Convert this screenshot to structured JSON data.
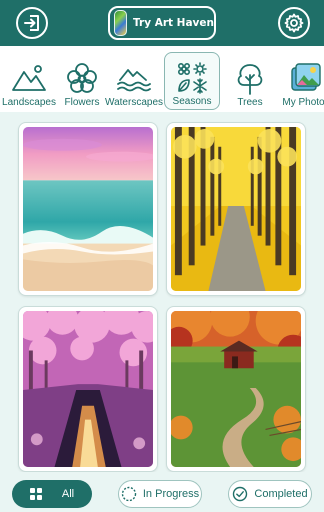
{
  "header": {
    "try_label": "Try Art Haven",
    "exit_icon": "exit-icon",
    "settings_icon": "gear-icon"
  },
  "categories": [
    {
      "label": "Landscapes",
      "icon": "mountains-icon"
    },
    {
      "label": "Flowers",
      "icon": "flower-icon"
    },
    {
      "label": "Waterscapes",
      "icon": "waves-icon"
    },
    {
      "label": "Seasons",
      "icon": "seasons-icon",
      "selected": true
    },
    {
      "label": "Trees",
      "icon": "tree-icon"
    },
    {
      "label": "My Photos",
      "icon": "photos-icon"
    }
  ],
  "artworks": [
    {
      "subject": "beach-sunset"
    },
    {
      "subject": "autumn-tree-road"
    },
    {
      "subject": "cherry-blossom-canal"
    },
    {
      "subject": "autumn-farm"
    }
  ],
  "filters": {
    "all_label": "All",
    "in_progress_label": "In Progress",
    "completed_label": "Completed",
    "active": "All"
  },
  "colors": {
    "primary": "#1f6f68",
    "background": "#e9f5f3"
  }
}
